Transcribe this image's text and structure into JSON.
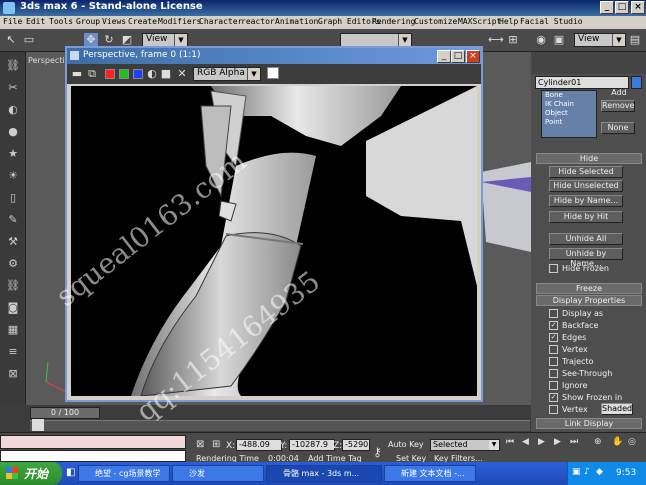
{
  "window": {
    "title": "3ds max 6 - Stand-alone License",
    "buttons": [
      "_",
      "□",
      "×"
    ]
  },
  "menu": [
    "File",
    "Edit",
    "Tools",
    "Group",
    "Views",
    "Create",
    "Modifiers",
    "Character",
    "reactor",
    "Animation",
    "Graph Editors",
    "Rendering",
    "Customize",
    "MAXScript",
    "Help",
    "Facial Studio"
  ],
  "toolbar": {
    "view_dropdown": "View",
    "view_dropdown_right": "View"
  },
  "viewport": {
    "label": "Perspective"
  },
  "render_window": {
    "title": "Perspective, frame 0 (1:1)",
    "channel": "RGB Alpha",
    "buttons": [
      "_",
      "□",
      "×"
    ]
  },
  "colors": {
    "swatch_red": "#ff2020",
    "swatch_green": "#20c020",
    "swatch_blue": "#2040ff",
    "title_blue": "#0a246a"
  },
  "right_panel": {
    "object_name": "Cylinder01",
    "list_items": [
      "Bone",
      "IK Chain Object",
      "Point"
    ],
    "add_button": "Add",
    "remove_button": "Remove",
    "none_button": "None",
    "hide_rollout": "Hide",
    "hide_buttons": [
      "Hide Selected",
      "Hide Unselected",
      "Hide by Name...",
      "Hide by Hit",
      "Unhide All",
      "Unhide by Name...",
      "Hide Frozen"
    ],
    "freeze_rollout": "Freeze",
    "display_rollout": "Display Properties",
    "display_options": [
      {
        "label": "Display as",
        "checked": false
      },
      {
        "label": "Backface",
        "checked": true
      },
      {
        "label": "Edges",
        "checked": true
      },
      {
        "label": "Vertex",
        "checked": false
      },
      {
        "label": "Trajecto",
        "checked": false
      },
      {
        "label": "See-Through",
        "checked": false
      },
      {
        "label": "Ignore",
        "checked": false
      },
      {
        "label": "Show Frozen in",
        "checked": true
      },
      {
        "label": "Vertex",
        "checked": false
      }
    ],
    "shaded_button": "Shaded",
    "link_rollout": "Link Display"
  },
  "timeline": {
    "frame_counter": "0 / 100"
  },
  "status": {
    "x_label": "X:",
    "x_value": "-488.09",
    "y_label": "Y:",
    "y_value": "-10287.9",
    "z_label": "Z:",
    "z_value": "-5290.",
    "auto_key": "Auto Key",
    "selected": "Selected",
    "set_key": "Set Key",
    "key_filters": "Key Filters...",
    "rendering_time_label": "Rendering Time",
    "rendering_time_value": "0:00:04",
    "add_time_tag": "Add Time Tag"
  },
  "taskbar": {
    "start": "开始",
    "tasks": [
      "绝望 - cg场景教学",
      "沙发",
      "骨骼 max - 3ds m...",
      "新建 文本文档 -..."
    ],
    "clock": "9:53"
  },
  "watermark": {
    "line1": "squeal0163.com",
    "line2": "qq:1154164935"
  }
}
